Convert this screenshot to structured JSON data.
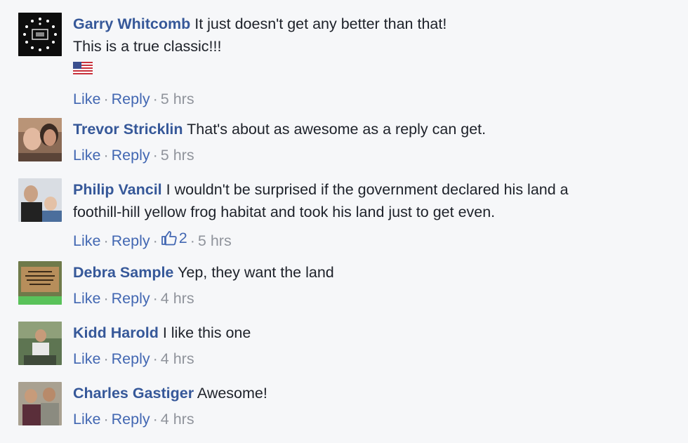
{
  "comments": [
    {
      "author": "Garry Whitcomb",
      "text": "It just doesn't get any better than that!",
      "text2": "This is a true classic!!!",
      "has_flag": true,
      "like_label": "Like",
      "reply_label": "Reply",
      "time": "5 hrs"
    },
    {
      "author": "Trevor Stricklin",
      "text": "That's about as awesome as a reply can get.",
      "like_label": "Like",
      "reply_label": "Reply",
      "time": "5 hrs"
    },
    {
      "author": "Philip Vancil",
      "text": "I wouldn't be surprised if the government declared his land a",
      "text2": "foothill-hill yellow frog habitat and took his land just to get even.",
      "like_label": "Like",
      "reply_label": "Reply",
      "likes": "2",
      "time": "5 hrs"
    },
    {
      "author": "Debra Sample",
      "text": "Yep, they want the land",
      "like_label": "Like",
      "reply_label": "Reply",
      "time": "4 hrs"
    },
    {
      "author": "Kidd Harold",
      "text": "I like this one",
      "like_label": "Like",
      "reply_label": "Reply",
      "time": "4 hrs"
    },
    {
      "author": "Charles Gastiger",
      "text": "Awesome!",
      "like_label": "Like",
      "reply_label": "Reply",
      "time": "4 hrs"
    }
  ],
  "colors": {
    "name": "#365899",
    "link": "#4267b2",
    "meta": "#90949c",
    "background": "#f6f7f9"
  }
}
